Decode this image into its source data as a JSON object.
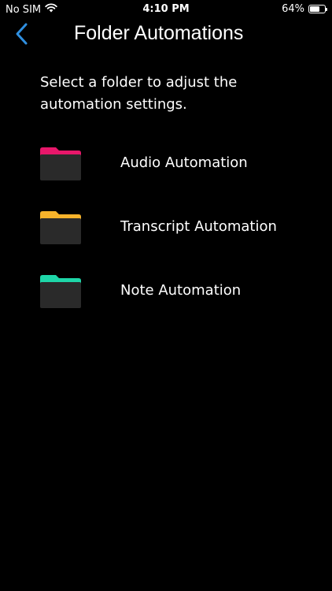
{
  "status_bar": {
    "carrier": "No SIM",
    "time": "4:10 PM",
    "battery_percent": "64%",
    "battery_level": 0.64
  },
  "nav": {
    "title": "Folder Automations"
  },
  "instructions": "Select a folder to adjust the automation settings.",
  "folders": [
    {
      "label": "Audio Automation",
      "tab_color": "#E8176A"
    },
    {
      "label": "Transcript Automation",
      "tab_color": "#F7B32B"
    },
    {
      "label": "Note Automation",
      "tab_color": "#1ED6A8"
    }
  ],
  "colors": {
    "background": "#000000",
    "accent": "#2F8FE0",
    "folder_body": "#2A2A2A",
    "text": "#FFFFFF"
  },
  "icons": {
    "back": "chevron-left-icon",
    "wifi": "wifi-icon",
    "battery": "battery-icon",
    "folder": "folder-icon"
  }
}
